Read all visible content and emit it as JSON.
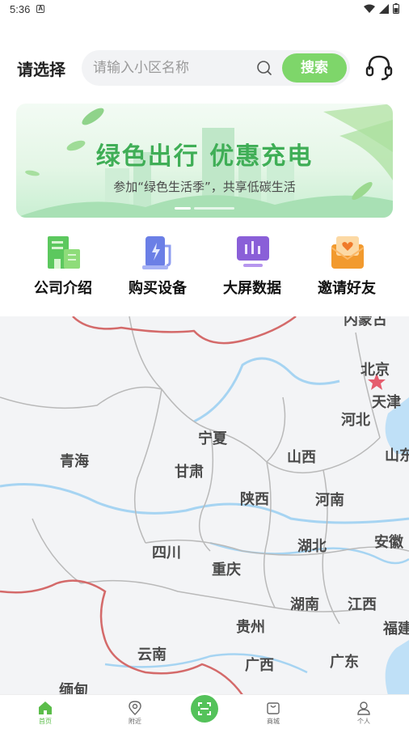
{
  "status_bar": {
    "time": "5:36",
    "notification_icon": "A"
  },
  "header": {
    "region_label": "请选择",
    "search_placeholder": "请输入小区名称",
    "search_button": "搜索"
  },
  "banner": {
    "title": "绿色出行  优惠充电",
    "subtitle": "参加“绿色生活季”，共享低碳生活"
  },
  "quick_menu": [
    {
      "label": "公司介绍",
      "icon": "building-icon"
    },
    {
      "label": "购买设备",
      "icon": "charger-icon"
    },
    {
      "label": "大屏数据",
      "icon": "screen-data-icon"
    },
    {
      "label": "邀请好友",
      "icon": "invite-icon"
    }
  ],
  "map": {
    "labels": [
      "内蒙古",
      "北京",
      "天津",
      "河北",
      "宁夏",
      "山西",
      "山东",
      "青海",
      "甘肃",
      "陕西",
      "河南",
      "湖北",
      "安徽",
      "四川",
      "重庆",
      "湖南",
      "江西",
      "贵州",
      "福建",
      "云南",
      "广西",
      "广东",
      "缅甸"
    ]
  },
  "bottom_nav": [
    {
      "label": "首页",
      "icon": "home-icon",
      "active": true
    },
    {
      "label": "附近",
      "icon": "location-icon",
      "active": false
    },
    {
      "label": "商城",
      "icon": "shop-icon",
      "active": false
    },
    {
      "label": "个人",
      "icon": "user-icon",
      "active": false
    }
  ],
  "colors": {
    "accent": "#7ed66a",
    "banner_title": "#3fae56",
    "nav_active": "#5bbd4a"
  }
}
